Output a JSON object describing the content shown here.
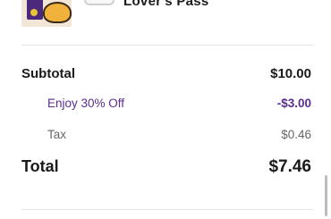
{
  "item": {
    "name": "Lover's Pass"
  },
  "summary": {
    "subtotal_label": "Subtotal",
    "subtotal_value": "$10.00",
    "discount_label": "Enjoy 30% Off",
    "discount_value": "-$3.00",
    "tax_label": "Tax",
    "tax_value": "$0.46",
    "total_label": "Total",
    "total_value": "$7.46"
  },
  "colors": {
    "accent_purple": "#5b2d8e",
    "text_dark": "#1a1a1a",
    "text_muted": "#666666",
    "divider": "#e4e4e4"
  }
}
